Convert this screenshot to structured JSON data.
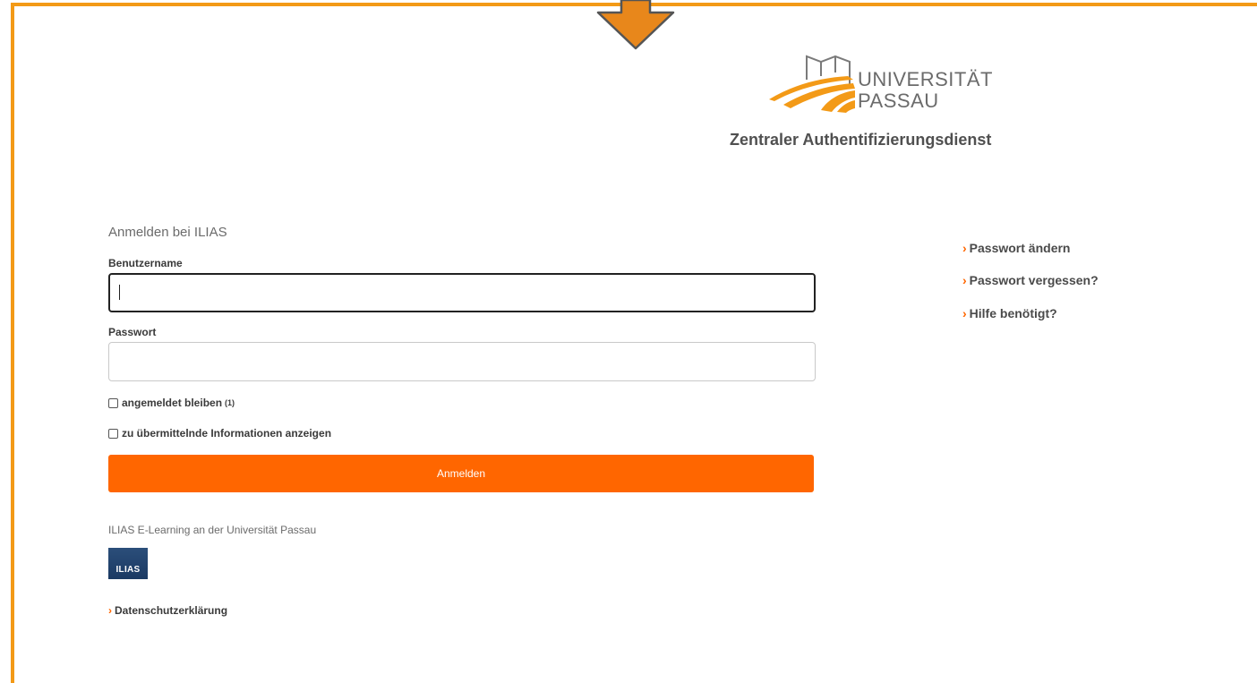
{
  "header": {
    "university_line1": "UNIVERSITÄT",
    "university_line2": "PASSAU",
    "service_title": "Zentraler Authentifizierungsdienst"
  },
  "form": {
    "heading": "Anmelden bei ILIAS",
    "username_label": "Benutzername",
    "username_value": "",
    "password_label": "Passwort",
    "password_value": "",
    "stay_logged_in_label": "angemeldet bleiben",
    "stay_logged_in_note": "(1)",
    "stay_logged_in_checked": false,
    "show_info_label": "zu übermittelnde Informationen anzeigen",
    "show_info_checked": false,
    "submit_label": "Anmelden"
  },
  "footer": {
    "service_text": "ILIAS E-Learning an der Universität Passau",
    "ilias_logo_text": "ILIAS",
    "privacy_link": "Datenschutzerklärung"
  },
  "side_links": [
    {
      "label": "Passwort ändern"
    },
    {
      "label": "Passwort vergessen?"
    },
    {
      "label": "Hilfe benötigt?"
    }
  ],
  "icons": {
    "link_chevron": "›",
    "annotation_arrow": "arrow-down-icon",
    "logo": "universitaet-passau-logo"
  },
  "colors": {
    "accent_orange": "#ff6600",
    "frame_orange": "#f39a17",
    "text_dark": "#3a3a3a",
    "text_muted": "#6b6b6b"
  }
}
